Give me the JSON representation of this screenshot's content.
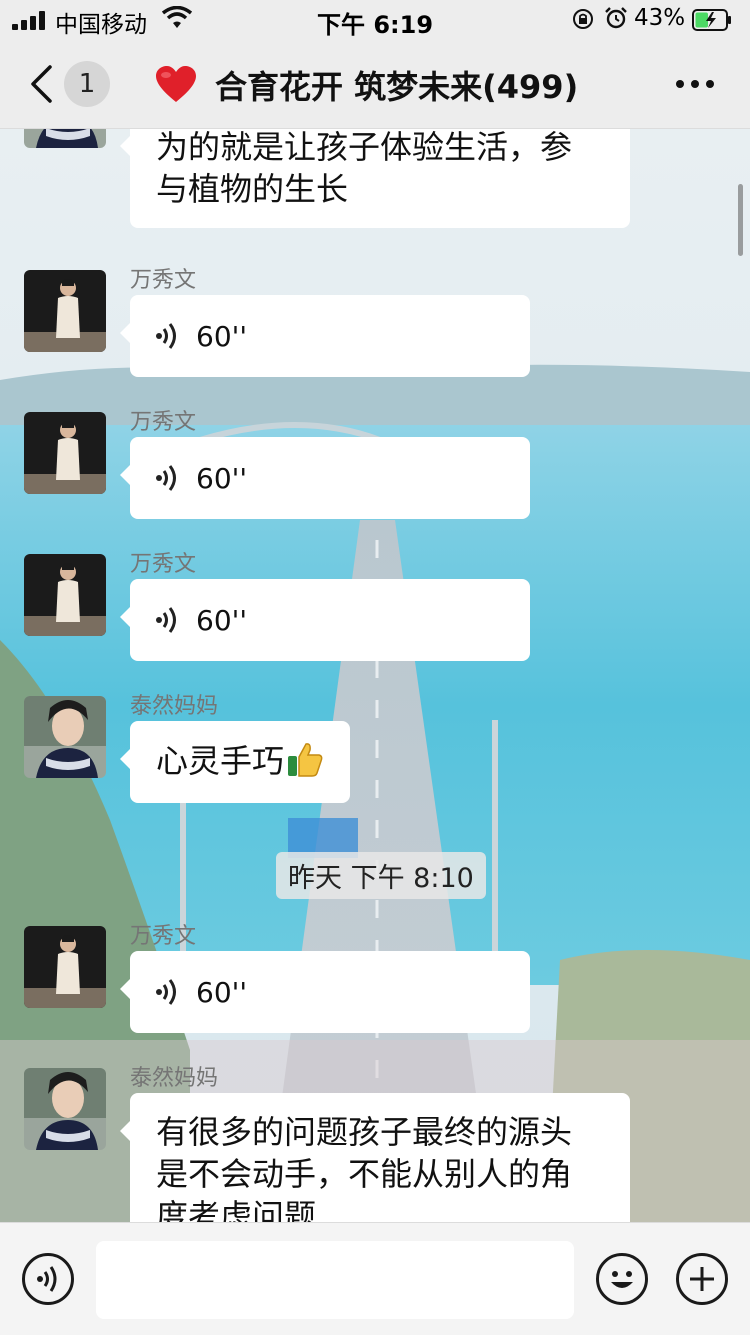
{
  "status_bar": {
    "carrier": "中国移动",
    "time": "下午 6:19",
    "battery_percent": "43%",
    "battery_level": 0.43
  },
  "nav": {
    "unread_count": "1",
    "title": "合育花开 筑梦未来(499)",
    "title_icon": "red-heart-icon"
  },
  "messages": [
    {
      "sender": "",
      "type": "text",
      "lines": [
        "为的就是让孩子体验生活，参",
        "与植物的生长"
      ],
      "avatar": "avatar-taiwan-mama"
    },
    {
      "sender": "万秀文",
      "type": "voice",
      "duration": "60''",
      "avatar": "avatar-wan-xiuwen"
    },
    {
      "sender": "万秀文",
      "type": "voice",
      "duration": "60''",
      "avatar": "avatar-wan-xiuwen"
    },
    {
      "sender": "万秀文",
      "type": "voice",
      "duration": "60''",
      "avatar": "avatar-wan-xiuwen"
    },
    {
      "sender": "泰然妈妈",
      "type": "text",
      "lines": [
        "心灵手巧"
      ],
      "emoji": "thumbs-up-icon",
      "avatar": "avatar-tairan-mama"
    },
    {
      "sender": "万秀文",
      "type": "voice",
      "duration": "60''",
      "avatar": "avatar-wan-xiuwen"
    },
    {
      "sender": "泰然妈妈",
      "type": "text",
      "lines": [
        "有很多的问题孩子最终的源头",
        "是不会动手，不能从别人的角",
        "度考虑问题"
      ],
      "avatar": "avatar-tairan-mama"
    }
  ],
  "timestamp": "昨天 下午 8:10",
  "input_bar": {
    "voice_icon": "voice-input-icon",
    "placeholder": "",
    "emoji_icon": "emoji-icon",
    "plus_icon": "plus-icon"
  },
  "colors": {
    "bar_bg": "#ededed",
    "bubble_bg": "#ffffff",
    "sender_text": "#757575",
    "heart": "#e0202a"
  }
}
